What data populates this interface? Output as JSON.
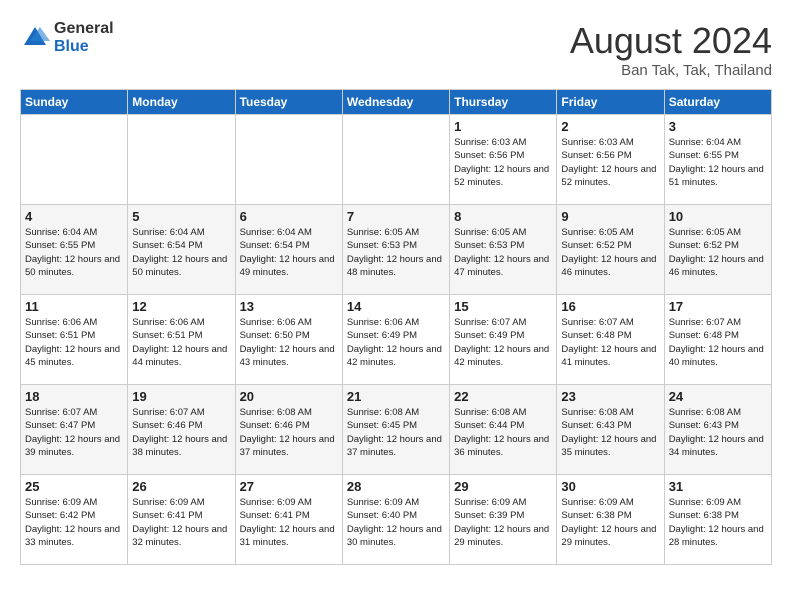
{
  "header": {
    "logo_general": "General",
    "logo_blue": "Blue",
    "month_title": "August 2024",
    "location": "Ban Tak, Tak, Thailand"
  },
  "days_of_week": [
    "Sunday",
    "Monday",
    "Tuesday",
    "Wednesday",
    "Thursday",
    "Friday",
    "Saturday"
  ],
  "weeks": [
    [
      {
        "day": "",
        "sunrise": "",
        "sunset": "",
        "daylight": ""
      },
      {
        "day": "",
        "sunrise": "",
        "sunset": "",
        "daylight": ""
      },
      {
        "day": "",
        "sunrise": "",
        "sunset": "",
        "daylight": ""
      },
      {
        "day": "",
        "sunrise": "",
        "sunset": "",
        "daylight": ""
      },
      {
        "day": "1",
        "sunrise": "Sunrise: 6:03 AM",
        "sunset": "Sunset: 6:56 PM",
        "daylight": "Daylight: 12 hours and 52 minutes."
      },
      {
        "day": "2",
        "sunrise": "Sunrise: 6:03 AM",
        "sunset": "Sunset: 6:56 PM",
        "daylight": "Daylight: 12 hours and 52 minutes."
      },
      {
        "day": "3",
        "sunrise": "Sunrise: 6:04 AM",
        "sunset": "Sunset: 6:55 PM",
        "daylight": "Daylight: 12 hours and 51 minutes."
      }
    ],
    [
      {
        "day": "4",
        "sunrise": "Sunrise: 6:04 AM",
        "sunset": "Sunset: 6:55 PM",
        "daylight": "Daylight: 12 hours and 50 minutes."
      },
      {
        "day": "5",
        "sunrise": "Sunrise: 6:04 AM",
        "sunset": "Sunset: 6:54 PM",
        "daylight": "Daylight: 12 hours and 50 minutes."
      },
      {
        "day": "6",
        "sunrise": "Sunrise: 6:04 AM",
        "sunset": "Sunset: 6:54 PM",
        "daylight": "Daylight: 12 hours and 49 minutes."
      },
      {
        "day": "7",
        "sunrise": "Sunrise: 6:05 AM",
        "sunset": "Sunset: 6:53 PM",
        "daylight": "Daylight: 12 hours and 48 minutes."
      },
      {
        "day": "8",
        "sunrise": "Sunrise: 6:05 AM",
        "sunset": "Sunset: 6:53 PM",
        "daylight": "Daylight: 12 hours and 47 minutes."
      },
      {
        "day": "9",
        "sunrise": "Sunrise: 6:05 AM",
        "sunset": "Sunset: 6:52 PM",
        "daylight": "Daylight: 12 hours and 46 minutes."
      },
      {
        "day": "10",
        "sunrise": "Sunrise: 6:05 AM",
        "sunset": "Sunset: 6:52 PM",
        "daylight": "Daylight: 12 hours and 46 minutes."
      }
    ],
    [
      {
        "day": "11",
        "sunrise": "Sunrise: 6:06 AM",
        "sunset": "Sunset: 6:51 PM",
        "daylight": "Daylight: 12 hours and 45 minutes."
      },
      {
        "day": "12",
        "sunrise": "Sunrise: 6:06 AM",
        "sunset": "Sunset: 6:51 PM",
        "daylight": "Daylight: 12 hours and 44 minutes."
      },
      {
        "day": "13",
        "sunrise": "Sunrise: 6:06 AM",
        "sunset": "Sunset: 6:50 PM",
        "daylight": "Daylight: 12 hours and 43 minutes."
      },
      {
        "day": "14",
        "sunrise": "Sunrise: 6:06 AM",
        "sunset": "Sunset: 6:49 PM",
        "daylight": "Daylight: 12 hours and 42 minutes."
      },
      {
        "day": "15",
        "sunrise": "Sunrise: 6:07 AM",
        "sunset": "Sunset: 6:49 PM",
        "daylight": "Daylight: 12 hours and 42 minutes."
      },
      {
        "day": "16",
        "sunrise": "Sunrise: 6:07 AM",
        "sunset": "Sunset: 6:48 PM",
        "daylight": "Daylight: 12 hours and 41 minutes."
      },
      {
        "day": "17",
        "sunrise": "Sunrise: 6:07 AM",
        "sunset": "Sunset: 6:48 PM",
        "daylight": "Daylight: 12 hours and 40 minutes."
      }
    ],
    [
      {
        "day": "18",
        "sunrise": "Sunrise: 6:07 AM",
        "sunset": "Sunset: 6:47 PM",
        "daylight": "Daylight: 12 hours and 39 minutes."
      },
      {
        "day": "19",
        "sunrise": "Sunrise: 6:07 AM",
        "sunset": "Sunset: 6:46 PM",
        "daylight": "Daylight: 12 hours and 38 minutes."
      },
      {
        "day": "20",
        "sunrise": "Sunrise: 6:08 AM",
        "sunset": "Sunset: 6:46 PM",
        "daylight": "Daylight: 12 hours and 37 minutes."
      },
      {
        "day": "21",
        "sunrise": "Sunrise: 6:08 AM",
        "sunset": "Sunset: 6:45 PM",
        "daylight": "Daylight: 12 hours and 37 minutes."
      },
      {
        "day": "22",
        "sunrise": "Sunrise: 6:08 AM",
        "sunset": "Sunset: 6:44 PM",
        "daylight": "Daylight: 12 hours and 36 minutes."
      },
      {
        "day": "23",
        "sunrise": "Sunrise: 6:08 AM",
        "sunset": "Sunset: 6:43 PM",
        "daylight": "Daylight: 12 hours and 35 minutes."
      },
      {
        "day": "24",
        "sunrise": "Sunrise: 6:08 AM",
        "sunset": "Sunset: 6:43 PM",
        "daylight": "Daylight: 12 hours and 34 minutes."
      }
    ],
    [
      {
        "day": "25",
        "sunrise": "Sunrise: 6:09 AM",
        "sunset": "Sunset: 6:42 PM",
        "daylight": "Daylight: 12 hours and 33 minutes."
      },
      {
        "day": "26",
        "sunrise": "Sunrise: 6:09 AM",
        "sunset": "Sunset: 6:41 PM",
        "daylight": "Daylight: 12 hours and 32 minutes."
      },
      {
        "day": "27",
        "sunrise": "Sunrise: 6:09 AM",
        "sunset": "Sunset: 6:41 PM",
        "daylight": "Daylight: 12 hours and 31 minutes."
      },
      {
        "day": "28",
        "sunrise": "Sunrise: 6:09 AM",
        "sunset": "Sunset: 6:40 PM",
        "daylight": "Daylight: 12 hours and 30 minutes."
      },
      {
        "day": "29",
        "sunrise": "Sunrise: 6:09 AM",
        "sunset": "Sunset: 6:39 PM",
        "daylight": "Daylight: 12 hours and 29 minutes."
      },
      {
        "day": "30",
        "sunrise": "Sunrise: 6:09 AM",
        "sunset": "Sunset: 6:38 PM",
        "daylight": "Daylight: 12 hours and 29 minutes."
      },
      {
        "day": "31",
        "sunrise": "Sunrise: 6:09 AM",
        "sunset": "Sunset: 6:38 PM",
        "daylight": "Daylight: 12 hours and 28 minutes."
      }
    ]
  ]
}
